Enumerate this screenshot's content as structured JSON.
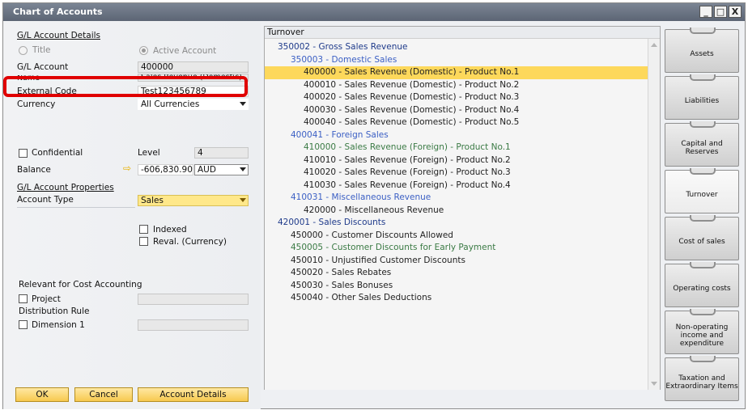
{
  "window": {
    "title": "Chart of Accounts",
    "controls": [
      "_",
      "□",
      "X"
    ]
  },
  "left": {
    "gl_details_heading": "G/L Account Details",
    "radio_title": "Title",
    "radio_active": "Active Account",
    "gl_account_label": "G/L Account",
    "gl_account_value": "400000",
    "name_label": "Name",
    "name_value": "Sales Revenue (Domestic)",
    "external_code_label": "External Code",
    "external_code_value": "Test123456789",
    "currency_label": "Currency",
    "currency_value": "All Currencies",
    "confidential_label": "Confidential",
    "level_label": "Level",
    "level_value": "4",
    "balance_label": "Balance",
    "balance_value": "-606,830.90",
    "balance_currency": "AUD",
    "properties_heading": "G/L Account Properties",
    "account_type_label": "Account Type",
    "account_type_value": "Sales",
    "indexed_label": "Indexed",
    "reval_label": "Reval. (Currency)",
    "cost_accounting_label": "Relevant for Cost Accounting",
    "project_label": "Project",
    "distribution_rule_label": "Distribution Rule",
    "dimension1_label": "Dimension 1"
  },
  "buttons": {
    "ok": "OK",
    "cancel": "Cancel",
    "account_details": "Account Details"
  },
  "tree": {
    "header": "Turnover",
    "rows": [
      {
        "text": "350002 - Gross Sales Revenue",
        "style": "title",
        "indent": 16
      },
      {
        "text": "350003 - Domestic Sales",
        "style": "blue",
        "indent": 32
      },
      {
        "text": "400000 - Sales Revenue (Domestic) - Product No.1",
        "style": "black",
        "indent": 48,
        "selected": true
      },
      {
        "text": "400010 - Sales Revenue (Domestic) - Product No.2",
        "style": "black",
        "indent": 48
      },
      {
        "text": "400020 - Sales Revenue (Domestic) - Product No.3",
        "style": "black",
        "indent": 48
      },
      {
        "text": "400030 - Sales Revenue (Domestic) - Product No.4",
        "style": "black",
        "indent": 48
      },
      {
        "text": "400040 - Sales Revenue (Domestic) - Product No.5",
        "style": "black",
        "indent": 48
      },
      {
        "text": "400041 - Foreign Sales",
        "style": "blue",
        "indent": 32
      },
      {
        "text": "410000 - Sales Revenue (Foreign) - Product No.1",
        "style": "green",
        "indent": 48
      },
      {
        "text": "410010 - Sales Revenue (Foreign) - Product No.2",
        "style": "black",
        "indent": 48
      },
      {
        "text": "410020 - Sales Revenue (Foreign) - Product No.3",
        "style": "black",
        "indent": 48
      },
      {
        "text": "410030 - Sales Revenue (Foreign) - Product No.4",
        "style": "black",
        "indent": 48
      },
      {
        "text": "410031 - Miscellaneous Revenue",
        "style": "blue",
        "indent": 32
      },
      {
        "text": "420000 - Miscellaneous Revenue",
        "style": "black",
        "indent": 48
      },
      {
        "text": "420001 - Sales Discounts",
        "style": "title",
        "indent": 16
      },
      {
        "text": "450000 - Customer Discounts Allowed",
        "style": "black",
        "indent": 32
      },
      {
        "text": "450005 - Customer Discounts for Early Payment",
        "style": "green",
        "indent": 32
      },
      {
        "text": "450010 - Unjustified Customer Discounts",
        "style": "black",
        "indent": 32
      },
      {
        "text": "450020 - Sales Rebates",
        "style": "black",
        "indent": 32
      },
      {
        "text": "450030 - Sales Bonuses",
        "style": "black",
        "indent": 32
      },
      {
        "text": "450040 - Other Sales Deductions",
        "style": "black",
        "indent": 32
      }
    ]
  },
  "tabs": [
    {
      "label": "Assets"
    },
    {
      "label": "Liabilities"
    },
    {
      "label": "Capital and Reserves"
    },
    {
      "label": "Turnover",
      "active": true
    },
    {
      "label": "Cost of sales"
    },
    {
      "label": "Operating costs"
    },
    {
      "label": "Non-operating income and expenditure"
    },
    {
      "label": "Taxation and Extraordinary Items"
    }
  ]
}
